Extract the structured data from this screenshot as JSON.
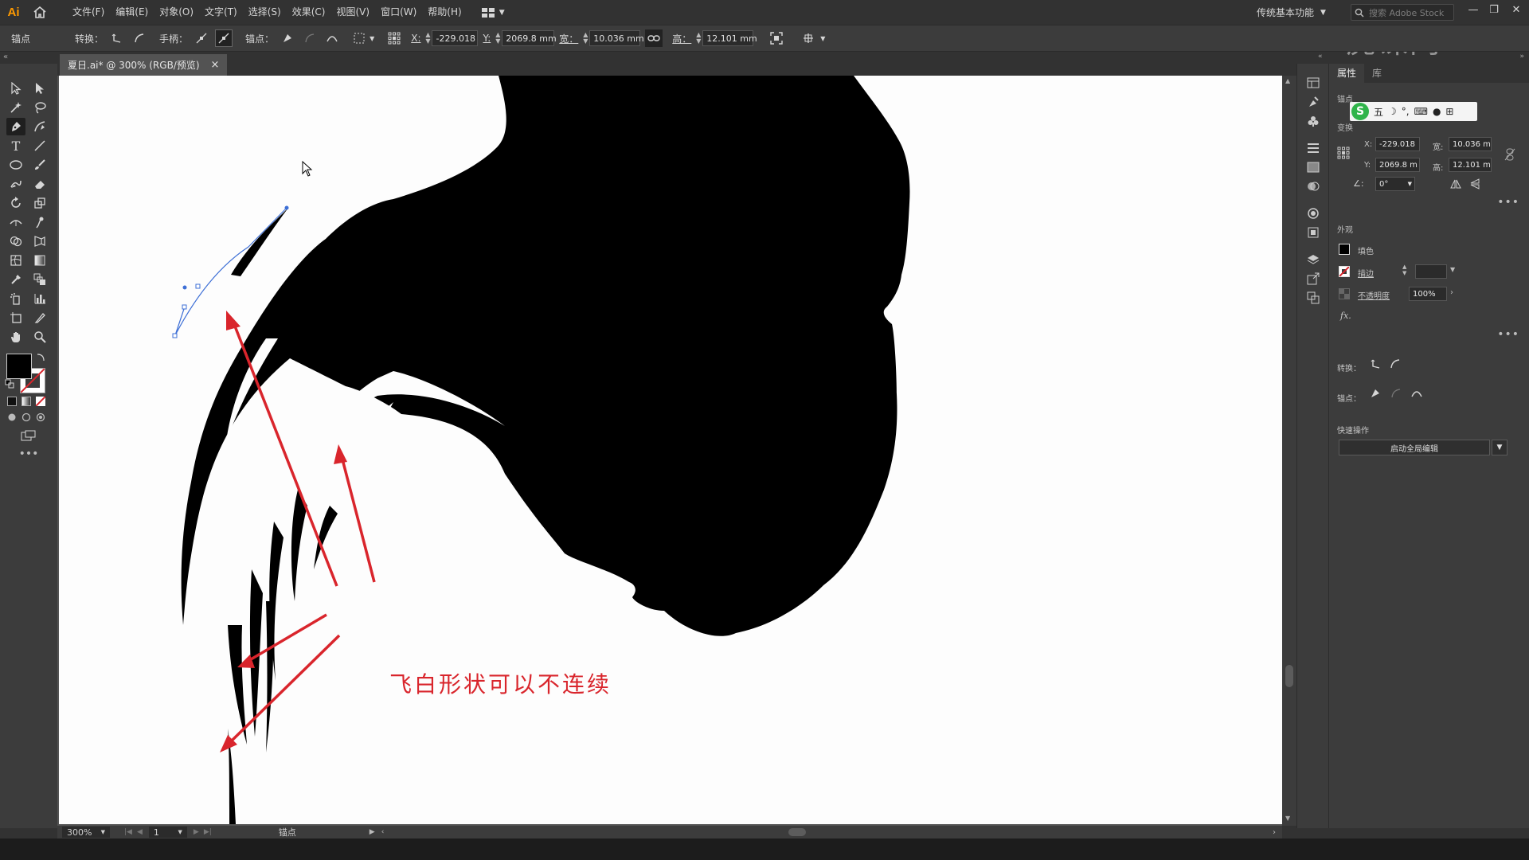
{
  "app": {
    "logo": "Ai"
  },
  "menu": [
    "文件(F)",
    "编辑(E)",
    "对象(O)",
    "文字(T)",
    "选择(S)",
    "效果(C)",
    "视图(V)",
    "窗口(W)",
    "帮助(H)"
  ],
  "workspace": {
    "label": "传统基本功能"
  },
  "search": {
    "placeholder": "搜索 Adobe Stock"
  },
  "watermark": "虎课网",
  "control_bar": {
    "anchor_label": "锚点",
    "convert_label": "转换：",
    "handle_label": "手柄：",
    "anchor_point_label": "锚点：",
    "x_label": "X:",
    "x_value": "-229.018",
    "y_label": "Y:",
    "y_value": "2069.8 mm",
    "w_label": "宽：",
    "w_value": "10.036 mm",
    "h_label": "高：",
    "h_value": "12.101 mm"
  },
  "document": {
    "tab_title": "夏日.ai* @ 300% (RGB/预览)",
    "close": "×"
  },
  "canvas": {
    "annotation": "飞白形状可以不连续",
    "annotation_color": "#d9252c"
  },
  "status": {
    "zoom": "300%",
    "page": "1",
    "tool": "锚点"
  },
  "properties": {
    "tabs": [
      "属性",
      "库"
    ],
    "section_anchor": "锚点",
    "section_transform": "变换",
    "x_label": "X:",
    "x_value": "-229.018",
    "y_label": "Y:",
    "y_value": "2069.8 m",
    "w_label": "宽:",
    "w_value": "10.036 m",
    "h_label": "高:",
    "h_value": "12.101 m",
    "angle_value": "0°",
    "section_appearance": "外观",
    "fill_label": "填色",
    "stroke_label": "描边",
    "opacity_label": "不透明度",
    "opacity_value": "100%",
    "fx_label": "fx.",
    "convert_label": "转换：",
    "anchor_label": "锚点：",
    "quick_actions": "快速操作",
    "global_edit_button": "启动全局编辑",
    "ime_label": "五"
  },
  "colors": {
    "accent": "#ff9a00",
    "annotation": "#d9252c",
    "ime_green": "#2fb44a"
  }
}
